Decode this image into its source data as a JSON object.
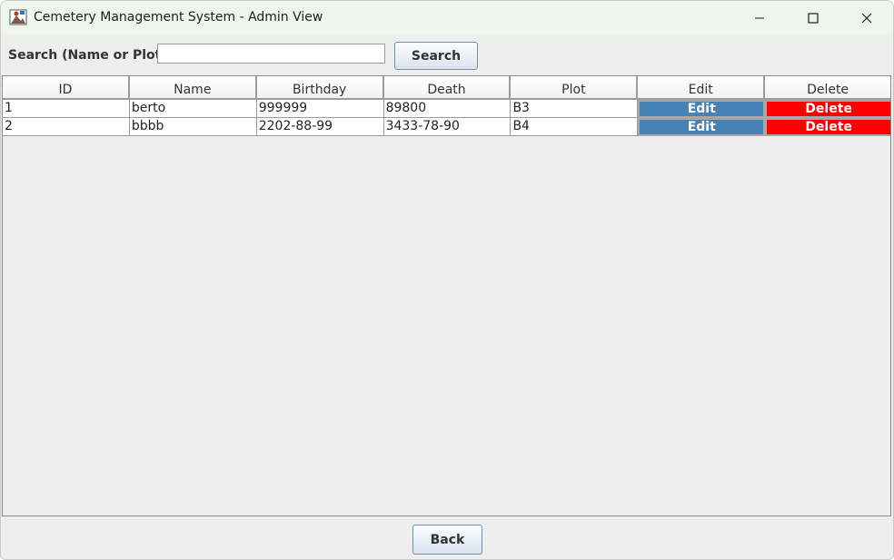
{
  "window": {
    "title": "Cemetery Management System - Admin View"
  },
  "icons": {
    "app": "app-icon",
    "minimize": "minimize-icon",
    "maximize": "maximize-icon",
    "close": "close-icon"
  },
  "search": {
    "label": "Search (Name or Plot):",
    "value": "",
    "placeholder": "",
    "button_label": "Search"
  },
  "table": {
    "columns": [
      "ID",
      "Name",
      "Birthday",
      "Death",
      "Plot",
      "Edit",
      "Delete"
    ],
    "rows": [
      {
        "id": "1",
        "name": "berto",
        "birthday": "999999",
        "death": "89800",
        "plot": "B3",
        "edit": "Edit",
        "delete": "Delete"
      },
      {
        "id": "2",
        "name": "bbbb",
        "birthday": "2202-88-99",
        "death": "3433-78-90",
        "plot": "B4",
        "edit": "Edit",
        "delete": "Delete"
      }
    ]
  },
  "footer": {
    "back_label": "Back"
  },
  "colors": {
    "edit_button": "#4682b4",
    "delete_button": "#ff0000",
    "titlebar": "#eef6ec",
    "background": "#eeeeee"
  }
}
